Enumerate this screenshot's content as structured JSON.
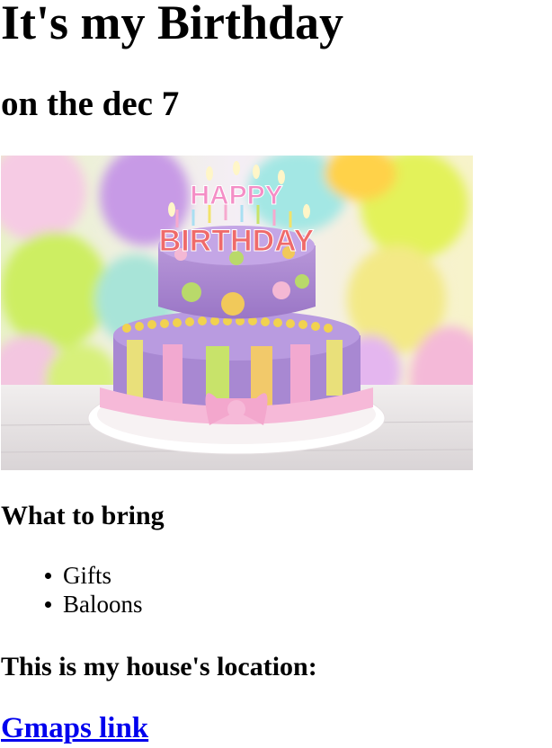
{
  "header": {
    "title": "It's my Birthday",
    "subtitle": "on the dec 7"
  },
  "image": {
    "cake_topper_line1": "HAPPY",
    "cake_topper_line2": "BIRTHDAY"
  },
  "bring": {
    "heading": "What to bring",
    "items": [
      "Gifts",
      "Baloons"
    ]
  },
  "location": {
    "heading": "This is my house's location:",
    "link_text": "Gmaps link"
  },
  "colors": {
    "link": "#0000ee",
    "text": "#000000",
    "background": "#ffffff"
  }
}
